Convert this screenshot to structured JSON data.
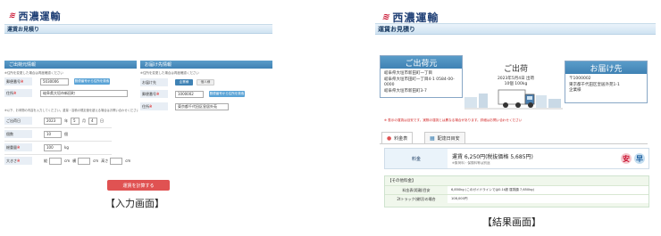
{
  "brand": {
    "logo_mark": "≋",
    "name": "西濃運輸"
  },
  "input": {
    "page_title": "運賃お見積り",
    "origin": {
      "header": "ご出荷元情報",
      "note": "※住所を変更した場合は再度確認ください",
      "postal_label": "郵便番号",
      "postal_value": "5030006",
      "postal_btn": "郵便番号から住所を検索",
      "address_label": "住所",
      "address_value": "岐阜県大垣市新田町"
    },
    "dest": {
      "header": "お届け先情報",
      "note": "※住所を変更した場合は再度確認ください",
      "type_label": "お届け先",
      "type_opt1": "企業様",
      "type_opt2": "個人様",
      "postal_label": "郵便番号",
      "postal_value": "1000002",
      "postal_btn": "郵便番号から住所を検索",
      "address_label": "住所",
      "address_value": "東京都千代田区皇居外苑"
    },
    "cargo_note": "※以下、お荷物の内容を入力してください。重量・容積の規定値を超える場合はお問い合わせください",
    "date": {
      "label": "ご出荷日",
      "year": "2023",
      "year_unit": "年",
      "month": "5",
      "month_unit": "月",
      "day": "4",
      "day_unit": "日"
    },
    "count": {
      "label": "個数",
      "value": "10",
      "unit": "個"
    },
    "weight": {
      "label": "総重量",
      "value": "100",
      "unit": "kg"
    },
    "size": {
      "label": "大きさ",
      "w_pre": "縦",
      "w_unit": "cm",
      "h_pre": "横",
      "h_unit": "cm",
      "d_pre": "高さ",
      "d_unit": "cm"
    },
    "submit": "運賃を計算する",
    "caption": "【入力画面】"
  },
  "result": {
    "page_title": "運賃お見積り",
    "origin_card": {
      "title": "ご出荷元",
      "line1": "岐阜県大垣市新田町一丁目",
      "line2": "岐阜県大垣市田町一丁目4-1",
      "phone": "0584-00-0000",
      "line3": "岐阜県大垣市新田町3-7"
    },
    "center": {
      "title": "ご出荷",
      "date": "2023年5月4日 出荷",
      "info": "10個 100kg"
    },
    "dest_card": {
      "title": "お届け先",
      "postal": "〒1000002",
      "address": "東京都千代田区皇居外苑1-1",
      "name": "企業様"
    },
    "warning": "※ 表示の運賃は目安です。実際の運賃とは異なる場合があります。詳細はお問い合わせください",
    "tabs": [
      {
        "label": "料金表"
      },
      {
        "label": "配達日目安"
      }
    ],
    "fare_label": "料金",
    "fare_value": "運賃 6,250円(税抜価格 5,685円)",
    "fare_sub": "※集荷料・保険料等は別途",
    "badge_safe": "安",
    "badge_fast": "早",
    "section_title": "【その他料金】",
    "rows": [
      {
        "label": "料金表(距離)目安",
        "value": "6,850kg (このガイドラインでは0.1t超 運賃額 7,650kg)"
      },
      {
        "label": "2tトラック(貸切)の場合",
        "value": "108,000円"
      }
    ],
    "caption": "【結果画面】"
  },
  "colors": {
    "brand_red": "#c8102e",
    "brand_navy": "#1f3f75",
    "header_blue": "#3f82b4",
    "submit_red": "#e05252"
  }
}
